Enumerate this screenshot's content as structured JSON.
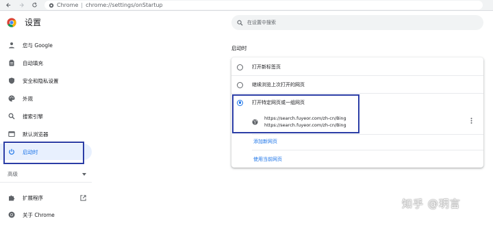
{
  "browser": {
    "tab_label": "Chrome",
    "separator": "|",
    "url": "chrome://settings/onStartup"
  },
  "sidebar": {
    "title": "设置",
    "items": [
      {
        "label": "您与 Google",
        "icon": "person-icon"
      },
      {
        "label": "自动填充",
        "icon": "clipboard-icon"
      },
      {
        "label": "安全和隐私设置",
        "icon": "shield-icon"
      },
      {
        "label": "外观",
        "icon": "palette-icon"
      },
      {
        "label": "搜索引擎",
        "icon": "search-icon"
      },
      {
        "label": "默认浏览器",
        "icon": "browser-icon"
      },
      {
        "label": "启动时",
        "icon": "power-icon",
        "active": true
      }
    ],
    "advanced_label": "高级",
    "extensions_label": "扩展程序",
    "about_label": "关于 Chrome"
  },
  "search": {
    "placeholder": "在设置中搜索"
  },
  "startup": {
    "section_title": "启动时",
    "options": [
      {
        "label": "打开新标签页",
        "selected": false
      },
      {
        "label": "继续浏览上次打开的网页",
        "selected": false
      },
      {
        "label": "打开特定网页或一组网页",
        "selected": true
      }
    ],
    "page_url_line1": "https://search.fuyeor.com/zh-cn/Bing",
    "page_url_line2": "https://search.fuyeor.com/zh-cn/Bing",
    "add_page_link": "添加新网页",
    "use_current_link": "使用当前网页"
  },
  "watermark": "知乎 @玥言",
  "colors": {
    "accent": "#1a73e8",
    "highlight_box": "#2b3da6",
    "active_bg": "#e8f0fe"
  }
}
